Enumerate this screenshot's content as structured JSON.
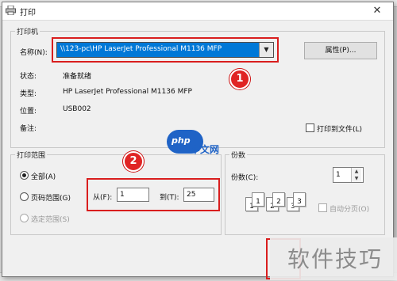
{
  "dialog": {
    "title": "打印",
    "close": "✕"
  },
  "printer": {
    "group_label": "打印机",
    "name_label": "名称(N):",
    "selected_printer": "\\\\123-pc\\HP LaserJet Professional M1136 MFP",
    "properties_button": "属性(P)...",
    "status_label": "状态:",
    "status_value": "准备就绪",
    "type_label": "类型:",
    "type_value": "HP LaserJet Professional M1136 MFP",
    "location_label": "位置:",
    "location_value": "USB002",
    "comment_label": "备注:",
    "comment_value": "",
    "print_to_file_label": "打印到文件(L)"
  },
  "range": {
    "group_label": "打印范围",
    "all_label": "全部(A)",
    "pages_label": "页码范围(G)",
    "selection_label": "选定范围(S)",
    "from_label": "从(F):",
    "from_value": "1",
    "to_label": "到(T):",
    "to_value": "25"
  },
  "copies": {
    "group_label": "份数",
    "count_label": "份数(C):",
    "count_value": "1",
    "collate_label": "自动分页(O)",
    "collate_pages": [
      "1",
      "1",
      "2",
      "2",
      "3",
      "3"
    ]
  },
  "annotations": {
    "badge_1": "1",
    "badge_2": "2",
    "highlight_color": "#d91e1e"
  },
  "watermark": {
    "text": "软件技巧",
    "logo_php": "php",
    "logo_cn": "中文网"
  }
}
